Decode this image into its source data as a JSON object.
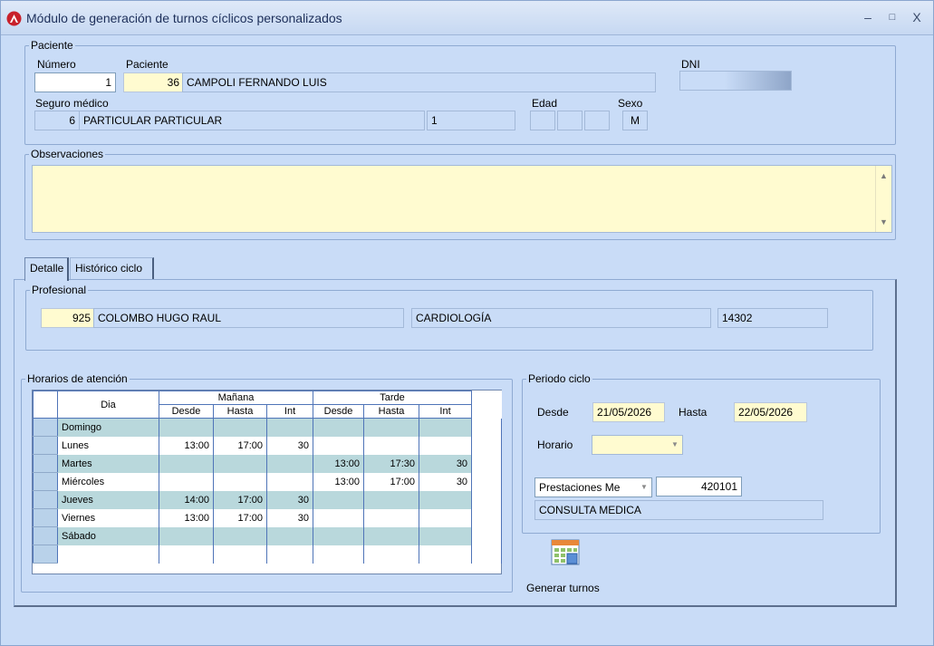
{
  "window": {
    "title": "Módulo de generación de turnos cíclicos personalizados",
    "minimize": "–",
    "maximize": "□",
    "close": "X"
  },
  "paciente": {
    "legend": "Paciente",
    "numero_label": "Número",
    "numero_value": "1",
    "paciente_label": "Paciente",
    "paciente_id": "36",
    "paciente_name": "CAMPOLI FERNANDO LUIS",
    "dni_label": "DNI",
    "seguro_label": "Seguro médico",
    "seguro_id": "6",
    "seguro_name": "PARTICULAR PARTICULAR",
    "seguro_extra": "1",
    "edad_label": "Edad",
    "sexo_label": "Sexo",
    "sexo_value": "M"
  },
  "observaciones": {
    "legend": "Observaciones",
    "scroll_up": "▲",
    "scroll_down": "▼"
  },
  "tabs": [
    {
      "label": "Detalle"
    },
    {
      "label": "Histórico ciclo"
    }
  ],
  "profesional": {
    "legend": "Profesional",
    "id": "925",
    "name": "COLOMBO HUGO RAUL",
    "especialidad": "CARDIOLOGÍA",
    "matricula": "14302"
  },
  "horarios": {
    "legend": "Horarios de atención",
    "header_dia": "Dia",
    "header_manana": "Mañana",
    "header_tarde": "Tarde",
    "header_desde": "Desde",
    "header_hasta": "Hasta",
    "header_int": "Int",
    "rows": [
      {
        "dia": "Domingo",
        "m_desde": "",
        "m_hasta": "",
        "m_int": "",
        "t_desde": "",
        "t_hasta": "",
        "t_int": ""
      },
      {
        "dia": "Lunes",
        "m_desde": "13:00",
        "m_hasta": "17:00",
        "m_int": "30",
        "t_desde": "",
        "t_hasta": "",
        "t_int": ""
      },
      {
        "dia": "Martes",
        "m_desde": "",
        "m_hasta": "",
        "m_int": "",
        "t_desde": "13:00",
        "t_hasta": "17:30",
        "t_int": "30"
      },
      {
        "dia": "Miércoles",
        "m_desde": "",
        "m_hasta": "",
        "m_int": "",
        "t_desde": "13:00",
        "t_hasta": "17:00",
        "t_int": "30"
      },
      {
        "dia": "Jueves",
        "m_desde": "14:00",
        "m_hasta": "17:00",
        "m_int": "30",
        "t_desde": "",
        "t_hasta": "",
        "t_int": ""
      },
      {
        "dia": "Viernes",
        "m_desde": "13:00",
        "m_hasta": "17:00",
        "m_int": "30",
        "t_desde": "",
        "t_hasta": "",
        "t_int": ""
      },
      {
        "dia": "Sábado",
        "m_desde": "",
        "m_hasta": "",
        "m_int": "",
        "t_desde": "",
        "t_hasta": "",
        "t_int": ""
      }
    ]
  },
  "periodo": {
    "legend": "Periodo ciclo",
    "desde_label": "Desde",
    "desde_value": "21/05/2026",
    "hasta_label": "Hasta",
    "hasta_value": "22/05/2026",
    "horario_label": "Horario",
    "horario_value": "",
    "prestaciones_value": "Prestaciones Me",
    "prestacion_code": "420101",
    "prestacion_name": "CONSULTA MEDICA"
  },
  "actions": {
    "generar_label": "Generar turnos"
  }
}
